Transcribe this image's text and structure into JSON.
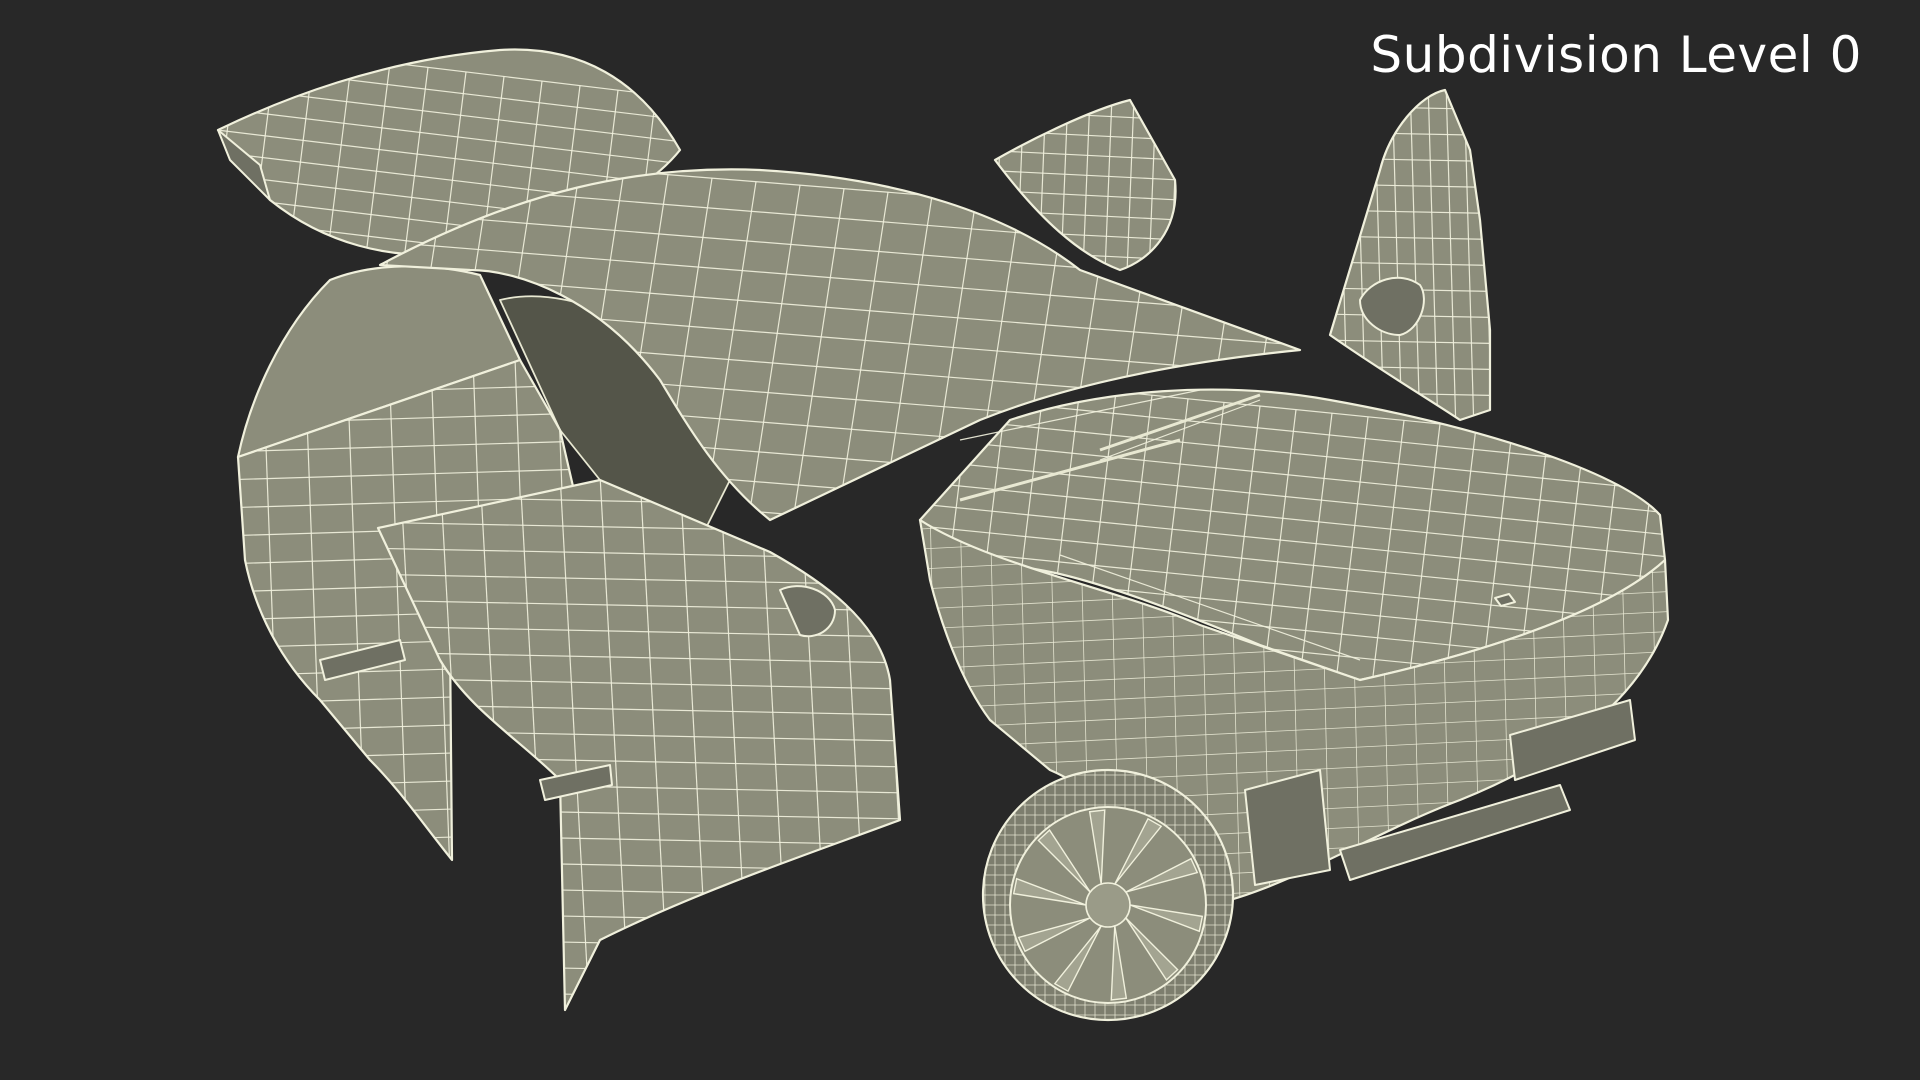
{
  "viewport": {
    "background": "#282828",
    "subdivision_label": "Subdivision Level 0",
    "wire_color": "#f0f0dc",
    "surface_color": "#8c8d7b"
  }
}
